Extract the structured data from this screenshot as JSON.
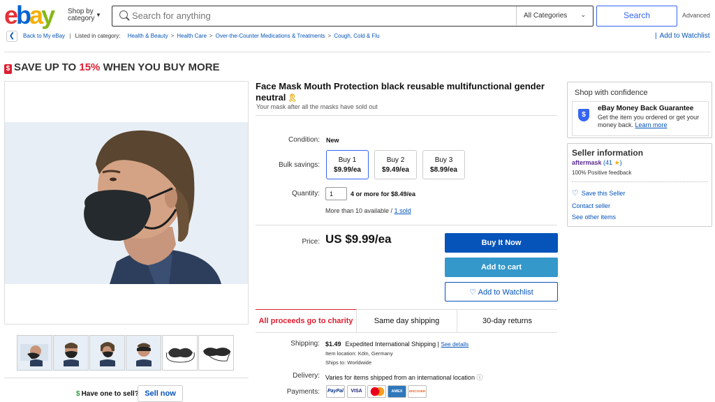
{
  "header": {
    "logo": [
      "e",
      "b",
      "a",
      "y"
    ],
    "shop_by": "Shop by category",
    "search_placeholder": "Search for anything",
    "category_select": "All Categories",
    "search_button": "Search",
    "advanced": "Advanced"
  },
  "breadcrumb": {
    "back": "Back to My eBay",
    "listed_in": "Listed in category:",
    "items": [
      "Health & Beauty",
      "Health Care",
      "Over-the-Counter Medications & Treatments",
      "Cough, Cold & Flu"
    ],
    "separator": ">",
    "add_to_watchlist": "Add to Watchlist"
  },
  "promo": {
    "prefix": "SAVE UP TO ",
    "percent": "15%",
    "suffix": " WHEN YOU BUY MORE",
    "icon": "dollar-tag-icon"
  },
  "listing": {
    "title": "Face Mask Mouth Protection black reusable multifunctional gender neutral",
    "subtitle": "Your mask after all the masks have sold out",
    "condition_label": "Condition:",
    "condition": "New",
    "bulk_label": "Bulk savings:",
    "bulk_options": [
      {
        "qty": "Buy 1",
        "price": "$9.99/ea",
        "selected": true
      },
      {
        "qty": "Buy 2",
        "price": "$9.49/ea",
        "selected": false
      },
      {
        "qty": "Buy 3",
        "price": "$8.99/ea",
        "selected": false
      }
    ],
    "quantity_label": "Quantity:",
    "quantity_value": "1",
    "quantity_offer": "4 or more for $8.49/ea",
    "availability": "More than 10 available / ",
    "sold": "1 sold",
    "price_label": "Price:",
    "price": "US $9.99/ea",
    "buy_now": "Buy It Now",
    "add_to_cart": "Add to cart",
    "add_to_watchlist": "Add to Watchlist",
    "features": [
      "All proceeds go to charity",
      "Same day shipping",
      "30-day returns"
    ],
    "shipping_label": "Shipping:",
    "shipping_cost": "$1.49",
    "shipping_method": "Expedited International Shipping",
    "see_details": "See details",
    "item_location": "Item location:  Köln, Germany",
    "ships_to": "Ships to:  Worldwide",
    "delivery_label": "Delivery:",
    "delivery": "Varies for items shipped from an international location",
    "payments_label": "Payments:",
    "payments": [
      "PayPal",
      "VISA",
      "MC",
      "AMEX",
      "DISCOVER"
    ]
  },
  "gallery": {
    "thumbnail_count": 6,
    "have_one": "Have one to sell?",
    "sell_now": "Sell now"
  },
  "confidence": {
    "title": "Shop with confidence",
    "mbg_title": "eBay Money Back Guarantee",
    "mbg_text": "Get the item you ordered or get your money back. ",
    "learn_more": "Learn more"
  },
  "seller": {
    "title": "Seller information",
    "name": "aftermask",
    "feedback_count": "(41 ",
    "feedback_close": ")",
    "positive": "100% Positive feedback",
    "save_seller": "Save this Seller",
    "contact": "Contact seller",
    "see_other": "See other items"
  },
  "colors": {
    "brand_blue": "#0654ba",
    "accent_red": "#dd1e31",
    "cart_blue": "#3498ca"
  }
}
